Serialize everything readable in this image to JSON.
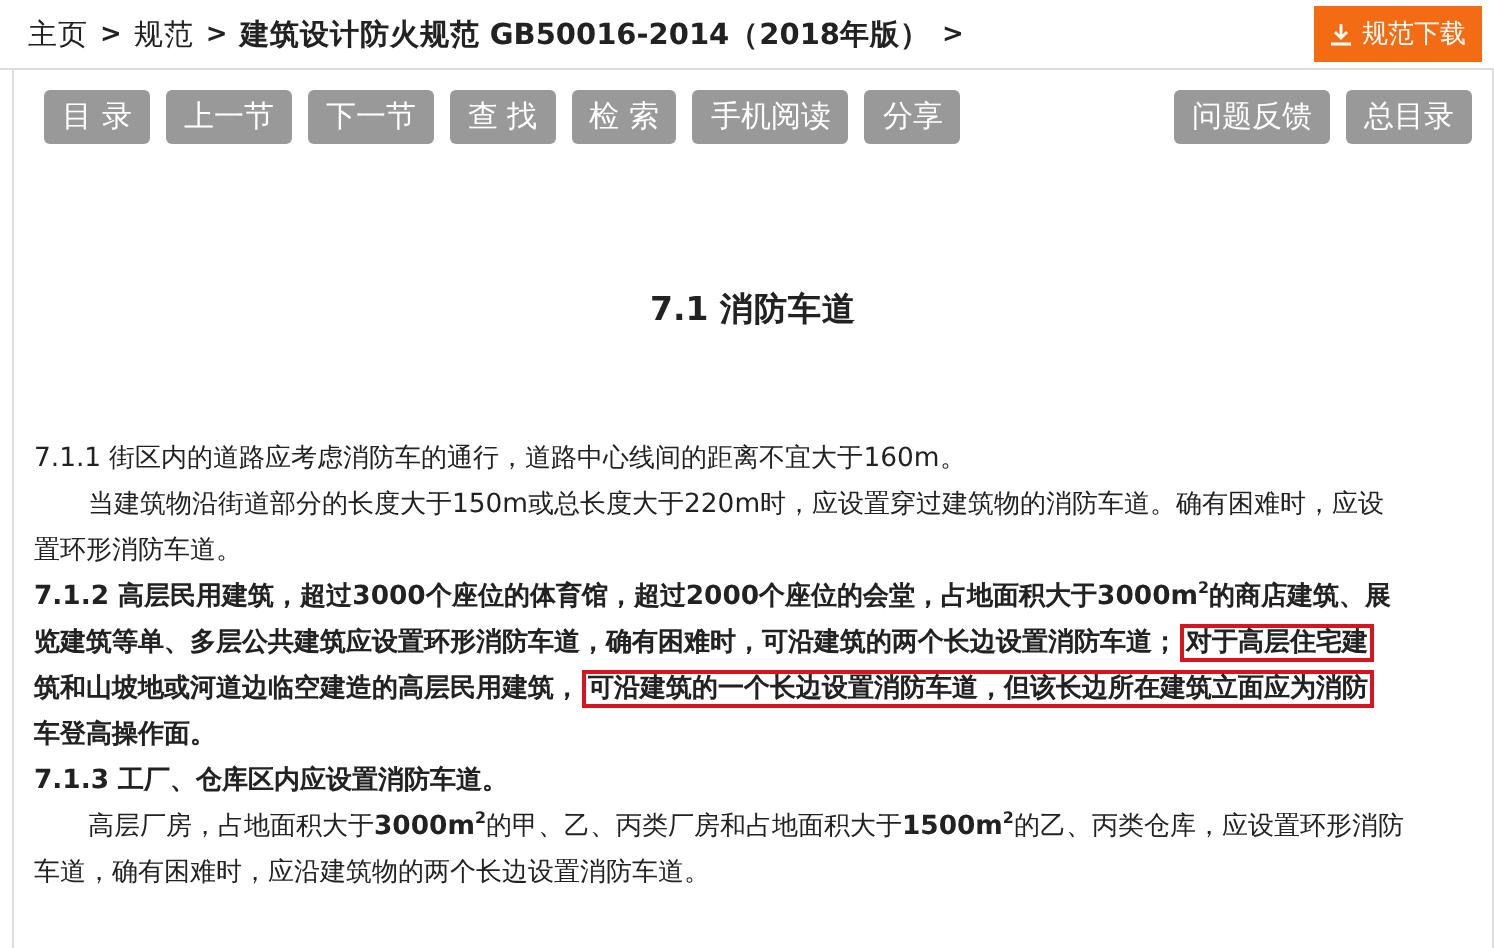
{
  "breadcrumb": [
    {
      "label": "主页",
      "bold": false
    },
    {
      "label": "规范",
      "bold": false
    },
    {
      "label": "建筑设计防火规范 GB50016-2014（2018年版）",
      "bold": true
    }
  ],
  "separator": ">",
  "download_button": {
    "label": "规范下载"
  },
  "toolbar_left": [
    "目 录",
    "上一节",
    "下一节",
    "查 找",
    "检 索",
    "手机阅读",
    "分享"
  ],
  "toolbar_right": [
    "问题反馈",
    "总目录"
  ],
  "section_title": "7.1  消防车道",
  "paragraphs": [
    {
      "bold": false,
      "indent": false,
      "lines": [
        [
          {
            "text": "7.1.1 街区内的道路应考虑消防车的通行，道路中心线间的距离不宜大于160m。",
            "boxed": false
          }
        ]
      ]
    },
    {
      "bold": false,
      "indent": true,
      "lines": [
        [
          {
            "text": "当建筑物沿街道部分的长度大于150m或总长度大于220m时，应设置穿过建筑物的消防车道。确有困难时，应设",
            "boxed": false
          }
        ],
        [
          {
            "text": "置环形消防车道。",
            "boxed": false
          }
        ]
      ]
    },
    {
      "bold": true,
      "indent": false,
      "lines": [
        [
          {
            "text": "7.1.2 高层民用建筑，超过3000个座位的体育馆，超过2000个座位的会堂，占地面积大于3000m$^{2}$的商店建筑、展",
            "boxed": false
          }
        ],
        [
          {
            "text": "览建筑等单、多层公共建筑应设置环形消防车道，确有困难时，可沿建筑的两个长边设置消防车道；",
            "boxed": false
          },
          {
            "text": "对于高层住宅建",
            "boxed": true
          }
        ],
        [
          {
            "text": "筑和山坡地或河道边临空建造的高层民用建筑，",
            "boxed": false
          },
          {
            "text": "可沿建筑的一个长边设置消防车道，但该长边所在建筑立面应为消防",
            "boxed": true
          }
        ],
        [
          {
            "text": "车登高操作面。",
            "boxed": false
          }
        ]
      ]
    },
    {
      "bold": true,
      "indent": false,
      "lines": [
        [
          {
            "text": "7.1.3 工厂、仓库区内应设置消防车道。",
            "boxed": false
          }
        ]
      ]
    },
    {
      "bold": false,
      "indent": true,
      "lines": [
        [
          {
            "text": "高层厂房，占地面积大于**3000m$^{2}$**的甲、乙、丙类厂房和占地面积大于**1500m$^{2}$**的乙、丙类仓库，应设置环形消防",
            "boxed": false
          }
        ],
        [
          {
            "text": "车道，确有困难时，应沿建筑物的两个长边设置消防车道。",
            "boxed": false
          }
        ]
      ]
    }
  ]
}
